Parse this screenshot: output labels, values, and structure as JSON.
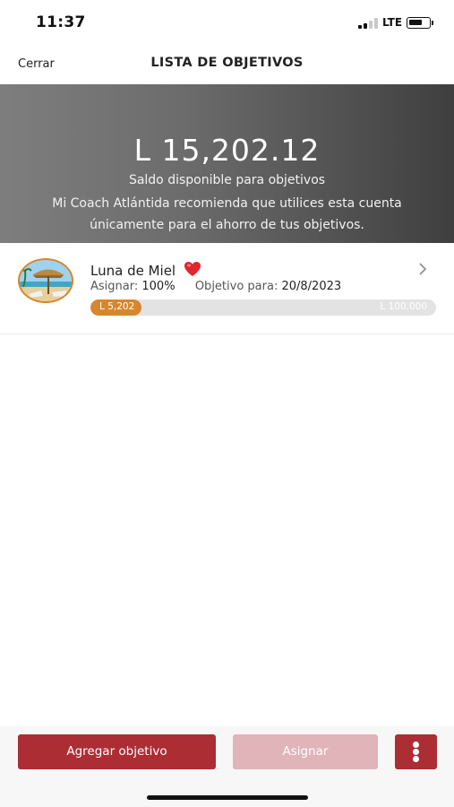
{
  "status_bar": {
    "time": "11:37",
    "network": "LTE",
    "signal_bars_active": 2,
    "signal_bars_total": 4,
    "battery_level": 0.55
  },
  "nav": {
    "close_label": "Cerrar",
    "title": "LISTA DE OBJETIVOS"
  },
  "balance": {
    "amount": "L 15,202.12",
    "label": "Saldo disponible para objetivos",
    "recommendation": "Mi Coach Atlántida recomienda que utilices esta cuenta únicamente para el ahorro de tus objetivos."
  },
  "goals": [
    {
      "name": "Luna de Miel",
      "icon": "heart-icon",
      "assign_label": "Asignar:",
      "assign_value": "100%",
      "target_date_label": "Objetivo para:",
      "target_date": "20/8/2023",
      "current_amount": "L 5,202",
      "target_amount": "L 100,000",
      "progress": 0.052
    }
  ],
  "actions": {
    "add_goal_label": "Agregar objetivo",
    "assign_label": "Asignar",
    "more_icon": "more-vertical-icon"
  },
  "colors": {
    "brand_red": "#ad2d35",
    "brand_red_disabled": "#e0b4b8",
    "progress_orange": "#d8862c",
    "banner_dark": "#3f3f3f",
    "banner_light": "#7e7e7e"
  }
}
